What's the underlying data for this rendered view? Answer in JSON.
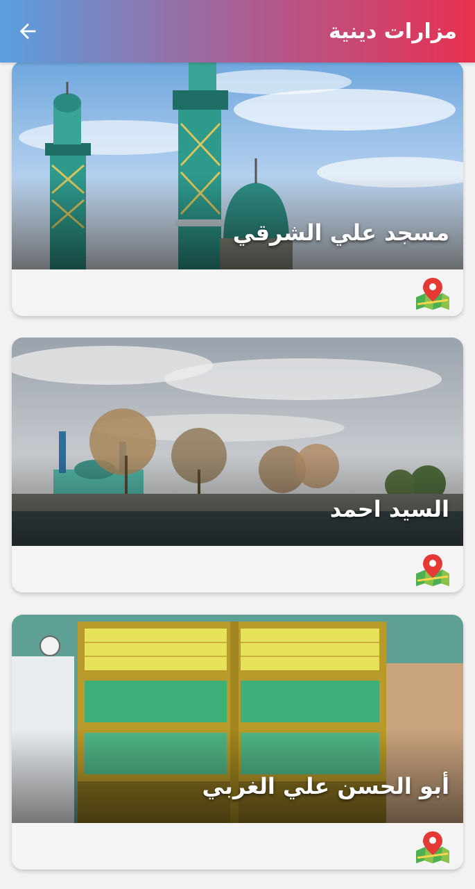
{
  "appbar": {
    "title": "مزارات دينية",
    "back_icon": "arrow-left-icon"
  },
  "colors": {
    "gradient_start": "#5a9fe0",
    "gradient_end": "#e8304f"
  },
  "cards": [
    {
      "title": "مسجد علي الشرقي",
      "image": "mosque-minarets-image",
      "action_icon": "map-pin-icon"
    },
    {
      "title": "السيد احمد",
      "image": "riverside-shrine-image",
      "action_icon": "map-pin-icon"
    },
    {
      "title": "أبو الحسن علي الغربي",
      "image": "shrine-interior-image",
      "action_icon": "map-pin-icon"
    }
  ]
}
